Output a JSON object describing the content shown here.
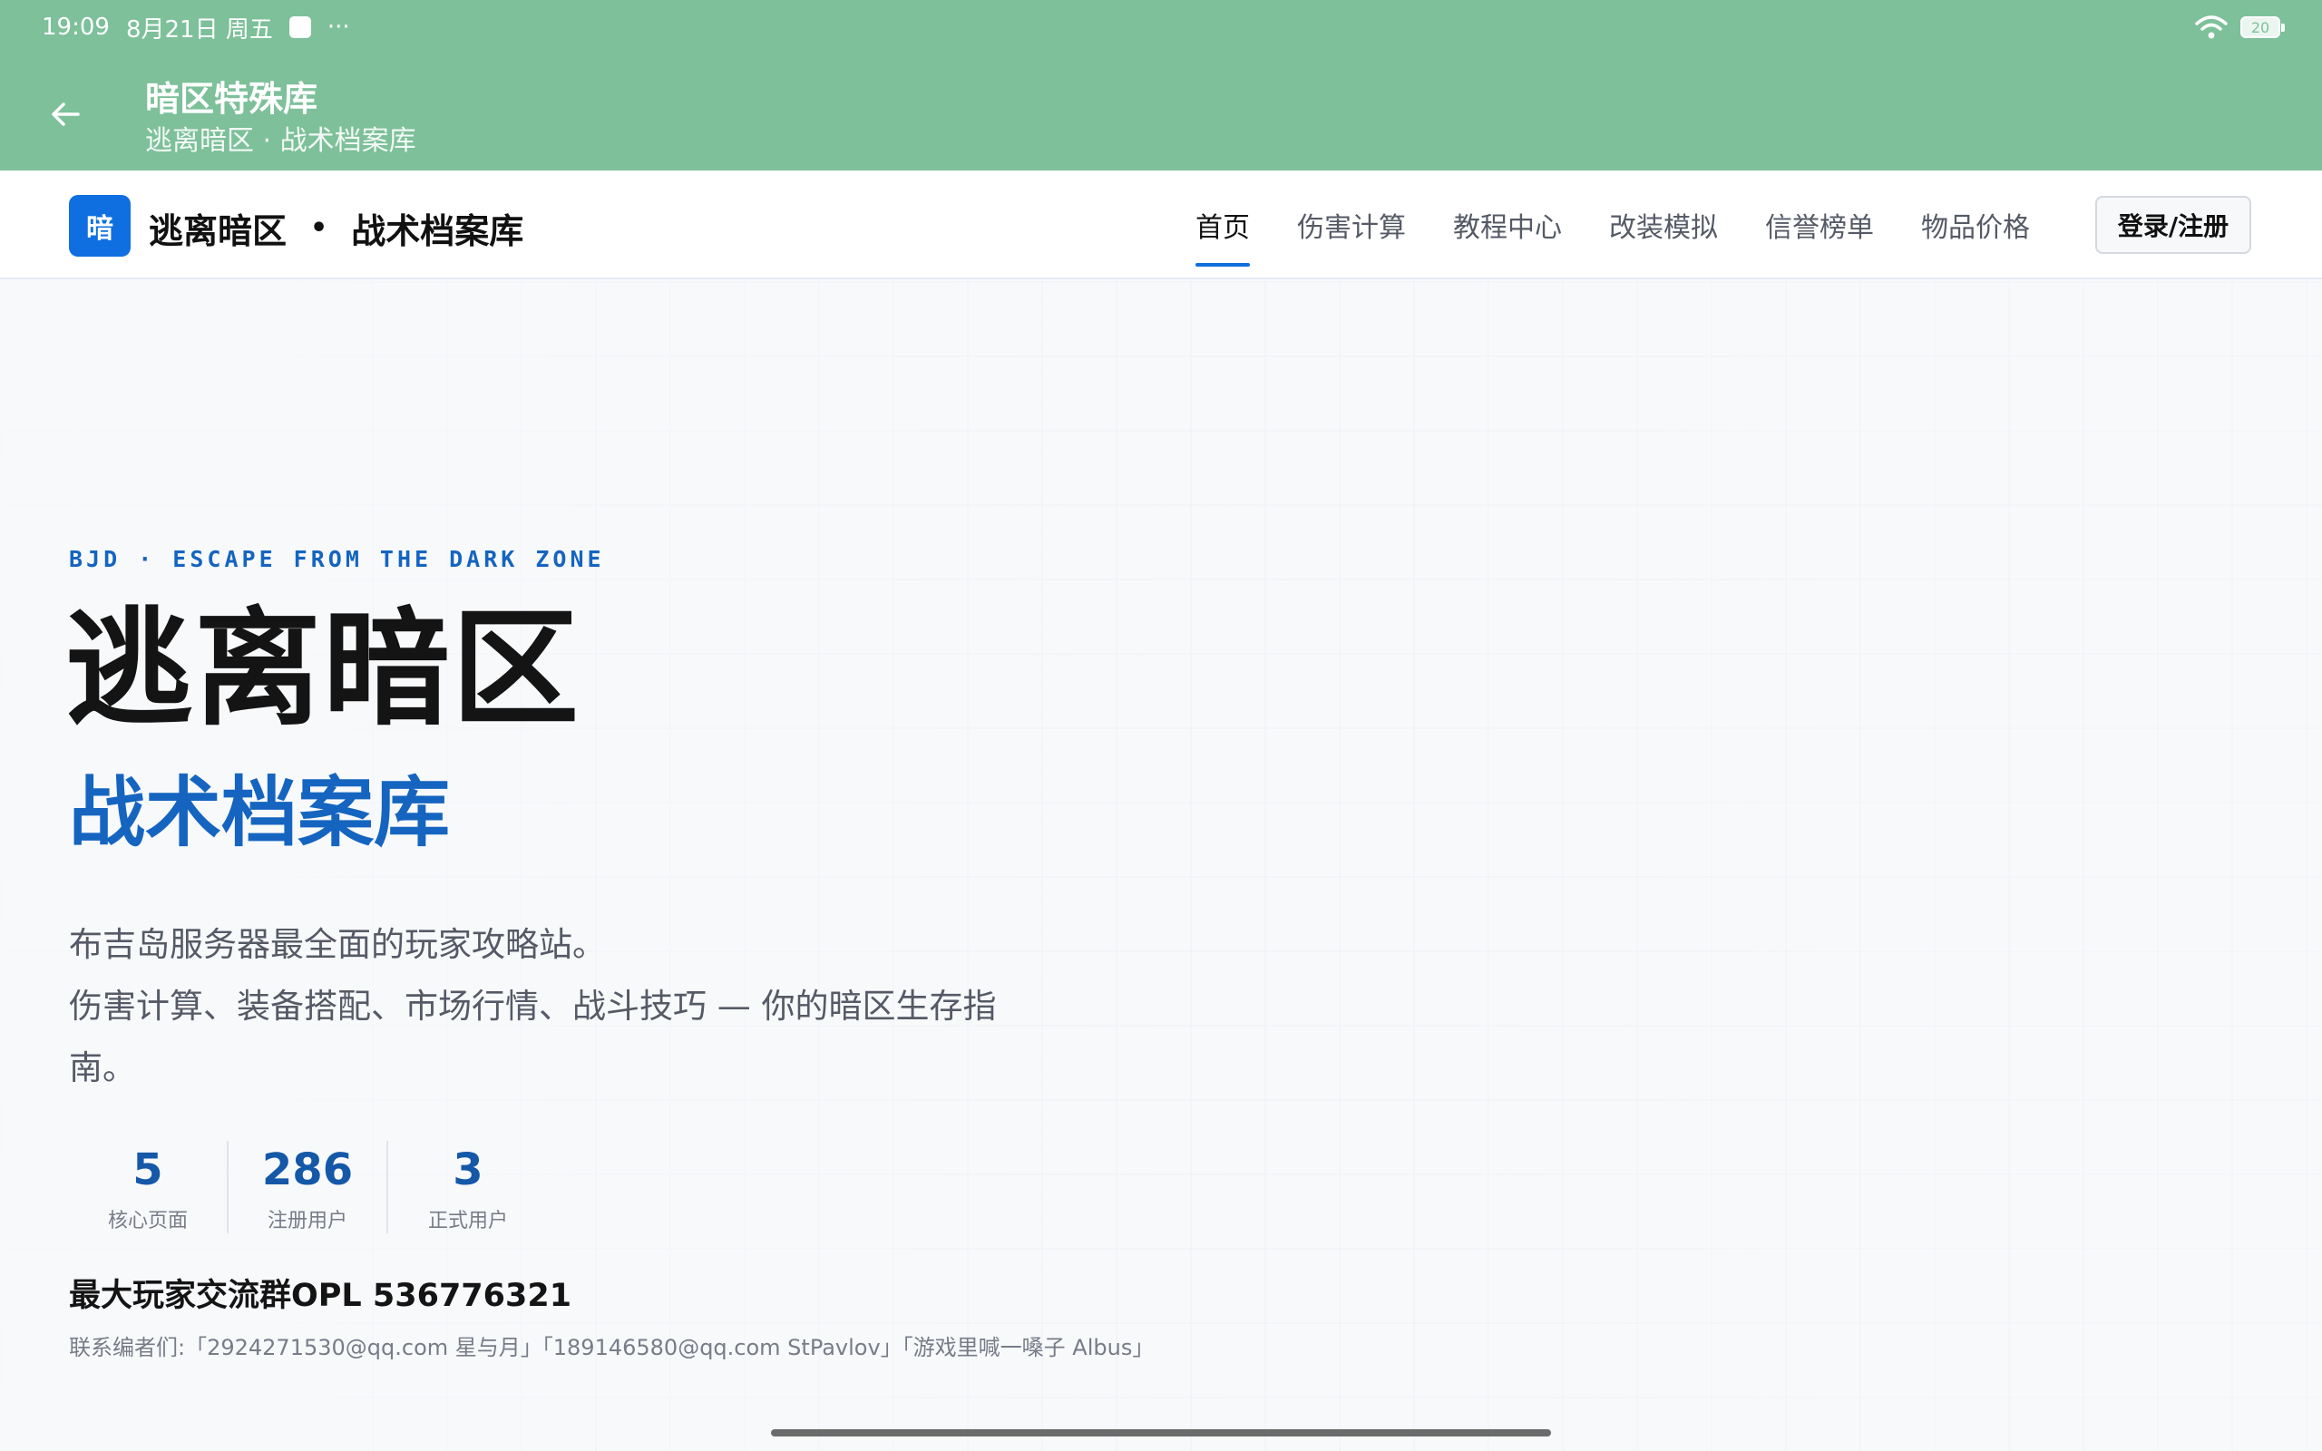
{
  "status_bar": {
    "time": "19:09",
    "date": "8月21日 周五",
    "dots": "···",
    "battery": "20"
  },
  "app_bar": {
    "title": "暗区特殊库",
    "subtitle": "逃离暗区 · 战术档案库"
  },
  "header": {
    "logo_char": "暗",
    "brand_main": "逃离暗区",
    "brand_dot": "•",
    "brand_sub": "战术档案库",
    "nav": [
      {
        "label": "首页",
        "active": true
      },
      {
        "label": "伤害计算",
        "active": false
      },
      {
        "label": "教程中心",
        "active": false
      },
      {
        "label": "改装模拟",
        "active": false
      },
      {
        "label": "信誉榜单",
        "active": false
      },
      {
        "label": "物品价格",
        "active": false
      }
    ],
    "login_label": "登录/注册",
    "accent_color": "#0f6fe0"
  },
  "hero": {
    "eyebrow": "BJD · ESCAPE FROM THE DARK ZONE",
    "title": "逃离暗区",
    "subtitle": "战术档案库",
    "desc_line1": "布吉岛服务器最全面的玩家攻略站。",
    "desc_line2": "伤害计算、装备搭配、市场行情、战斗技巧 — 你的暗区生存指南。",
    "stats": [
      {
        "value": "5",
        "label": "核心页面"
      },
      {
        "value": "286",
        "label": "注册用户"
      },
      {
        "value": "3",
        "label": "正式用户"
      }
    ],
    "group_line": "最大玩家交流群OPL 536776321",
    "contact_line": "联系编者们:「2924271530@qq.com 星与月」「189146580@qq.com StPavlov」「游戏里喊一嗓子 Albus」"
  }
}
